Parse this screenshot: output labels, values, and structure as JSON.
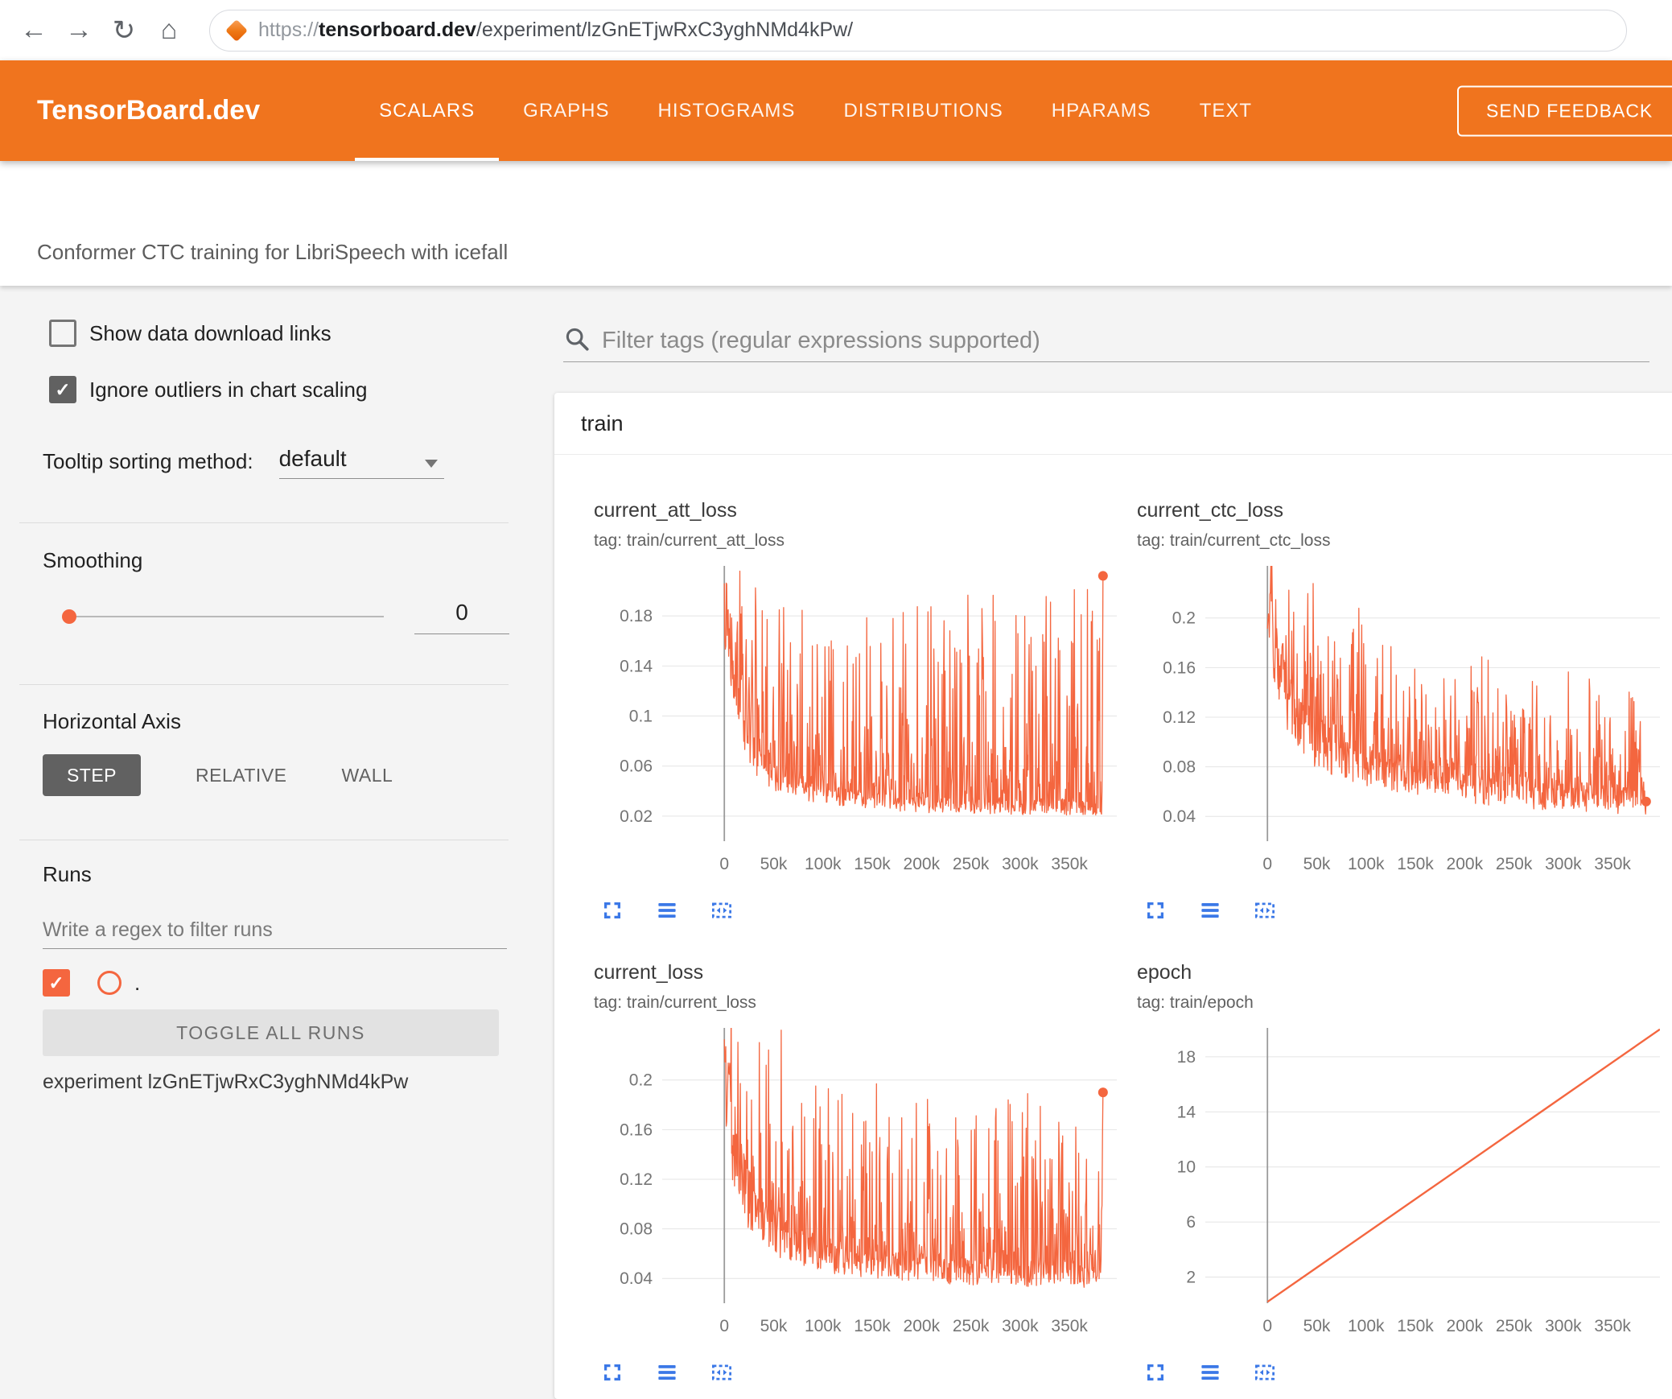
{
  "browser": {
    "url_scheme": "https://",
    "url_domain": "tensorboard.dev",
    "url_path": "/experiment/lzGnETjwRxC3yghNMd4kPw/"
  },
  "header": {
    "logo": "TensorBoard.dev",
    "tabs": [
      {
        "label": "SCALARS",
        "active": true
      },
      {
        "label": "GRAPHS",
        "active": false
      },
      {
        "label": "HISTOGRAMS",
        "active": false
      },
      {
        "label": "DISTRIBUTIONS",
        "active": false
      },
      {
        "label": "HPARAMS",
        "active": false
      },
      {
        "label": "TEXT",
        "active": false
      }
    ],
    "feedback_button": "SEND FEEDBACK"
  },
  "subtitle": "Conformer CTC training for LibriSpeech with icefall",
  "sidebar": {
    "show_download": {
      "label": "Show data download links",
      "checked": false
    },
    "ignore_outliers": {
      "label": "Ignore outliers in chart scaling",
      "checked": true
    },
    "tooltip_sorting": {
      "label": "Tooltip sorting method:",
      "value": "default"
    },
    "smoothing": {
      "label": "Smoothing",
      "value": "0"
    },
    "horizontal_axis": {
      "label": "Horizontal Axis",
      "options": [
        "STEP",
        "RELATIVE",
        "WALL"
      ],
      "selected": "STEP"
    },
    "runs": {
      "label": "Runs",
      "filter_placeholder": "Write a regex to filter runs",
      "run_label": ".",
      "run_checked": true,
      "toggle_button": "TOGGLE ALL RUNS",
      "experiment": "experiment lzGnETjwRxC3yghNMd4kPw"
    }
  },
  "main": {
    "filter_placeholder": "Filter tags (regular expressions supported)",
    "card_title": "train",
    "chart_toolbar_icons": [
      "fullscreen-icon",
      "data-lines-icon",
      "fit-domain-icon"
    ]
  },
  "colors": {
    "header_orange": "#f0741e",
    "run_color": "#f4663f",
    "icon_blue": "#3b78e7",
    "grid": "#e4e4e4",
    "zero_line": "#9a9a9a",
    "axis_text": "#757575"
  },
  "chart_data": [
    {
      "type": "line",
      "title": "current_att_loss",
      "tag": "tag: train/current_att_loss",
      "x_min": -63000,
      "x_max": 398000,
      "y_min": 0,
      "y_max": 0.22,
      "y_ticks": [
        {
          "v": 0.02,
          "label": "0.02"
        },
        {
          "v": 0.06,
          "label": "0.06"
        },
        {
          "v": 0.1,
          "label": "0.1"
        },
        {
          "v": 0.14,
          "label": "0.14"
        },
        {
          "v": 0.18,
          "label": "0.18"
        }
      ],
      "x_ticks": [
        {
          "v": 0,
          "label": "0"
        },
        {
          "v": 50000,
          "label": "50k"
        },
        {
          "v": 100000,
          "label": "100k"
        },
        {
          "v": 150000,
          "label": "150k"
        },
        {
          "v": 200000,
          "label": "200k"
        },
        {
          "v": 250000,
          "label": "250k"
        },
        {
          "v": 300000,
          "label": "300k"
        },
        {
          "v": 350000,
          "label": "350k"
        }
      ],
      "series": [
        {
          "name": ".",
          "max_step": 384000,
          "n_points": 780,
          "seed": 13,
          "spike_pow": 5,
          "stroke_width": 1.3,
          "base": [
            [
              0,
              0.2
            ],
            [
              8000,
              0.15
            ],
            [
              20000,
              0.09
            ],
            [
              40000,
              0.055
            ],
            [
              80000,
              0.042
            ],
            [
              120000,
              0.035
            ],
            [
              180000,
              0.03
            ],
            [
              260000,
              0.028
            ],
            [
              384000,
              0.026
            ]
          ],
          "spike": [
            [
              0,
              0.215
            ],
            [
              20000,
              0.215
            ],
            [
              60000,
              0.2
            ],
            [
              120000,
              0.17
            ],
            [
              200000,
              0.19
            ],
            [
              300000,
              0.2
            ],
            [
              384000,
              0.215
            ]
          ],
          "end_value": 0.212,
          "end_dot": true
        }
      ]
    },
    {
      "type": "line",
      "title": "current_ctc_loss",
      "tag": "tag: train/current_ctc_loss",
      "x_min": -63000,
      "x_max": 398000,
      "y_min": 0.02,
      "y_max": 0.242,
      "y_ticks": [
        {
          "v": 0.04,
          "label": "0.04"
        },
        {
          "v": 0.08,
          "label": "0.08"
        },
        {
          "v": 0.12,
          "label": "0.12"
        },
        {
          "v": 0.16,
          "label": "0.16"
        },
        {
          "v": 0.2,
          "label": "0.2"
        }
      ],
      "x_ticks": [
        {
          "v": 0,
          "label": "0"
        },
        {
          "v": 50000,
          "label": "50k"
        },
        {
          "v": 100000,
          "label": "100k"
        },
        {
          "v": 150000,
          "label": "150k"
        },
        {
          "v": 200000,
          "label": "200k"
        },
        {
          "v": 250000,
          "label": "250k"
        },
        {
          "v": 300000,
          "label": "300k"
        },
        {
          "v": 350000,
          "label": "350k"
        }
      ],
      "series": [
        {
          "name": ".",
          "max_step": 384000,
          "n_points": 780,
          "seed": 29,
          "spike_pow": 5,
          "stroke_width": 1.3,
          "base": [
            [
              0,
              0.22
            ],
            [
              10000,
              0.16
            ],
            [
              25000,
              0.12
            ],
            [
              50000,
              0.1
            ],
            [
              100000,
              0.082
            ],
            [
              150000,
              0.072
            ],
            [
              200000,
              0.065
            ],
            [
              280000,
              0.058
            ],
            [
              384000,
              0.052
            ]
          ],
          "spike": [
            [
              0,
              0.24
            ],
            [
              30000,
              0.24
            ],
            [
              80000,
              0.2
            ],
            [
              150000,
              0.17
            ],
            [
              250000,
              0.16
            ],
            [
              384000,
              0.14
            ]
          ],
          "end_value": 0.052,
          "end_dot": true
        }
      ]
    },
    {
      "type": "line",
      "title": "current_loss",
      "tag": "tag: train/current_loss",
      "x_min": -63000,
      "x_max": 398000,
      "y_min": 0.02,
      "y_max": 0.242,
      "y_ticks": [
        {
          "v": 0.04,
          "label": "0.04"
        },
        {
          "v": 0.08,
          "label": "0.08"
        },
        {
          "v": 0.12,
          "label": "0.12"
        },
        {
          "v": 0.16,
          "label": "0.16"
        },
        {
          "v": 0.2,
          "label": "0.2"
        }
      ],
      "x_ticks": [
        {
          "v": 0,
          "label": "0"
        },
        {
          "v": 50000,
          "label": "50k"
        },
        {
          "v": 100000,
          "label": "100k"
        },
        {
          "v": 150000,
          "label": "150k"
        },
        {
          "v": 200000,
          "label": "200k"
        },
        {
          "v": 250000,
          "label": "250k"
        },
        {
          "v": 300000,
          "label": "300k"
        },
        {
          "v": 350000,
          "label": "350k"
        }
      ],
      "series": [
        {
          "name": ".",
          "max_step": 384000,
          "n_points": 780,
          "seed": 47,
          "spike_pow": 5,
          "stroke_width": 1.3,
          "base": [
            [
              0,
              0.22
            ],
            [
              10000,
              0.14
            ],
            [
              30000,
              0.09
            ],
            [
              60000,
              0.07
            ],
            [
              100000,
              0.058
            ],
            [
              160000,
              0.05
            ],
            [
              240000,
              0.045
            ],
            [
              384000,
              0.04
            ]
          ],
          "spike": [
            [
              0,
              0.24
            ],
            [
              40000,
              0.24
            ],
            [
              100000,
              0.21
            ],
            [
              180000,
              0.19
            ],
            [
              280000,
              0.19
            ],
            [
              384000,
              0.16
            ]
          ],
          "end_value": 0.19,
          "end_dot": true
        }
      ]
    },
    {
      "type": "line",
      "title": "epoch",
      "tag": "tag: train/epoch",
      "x_min": -63000,
      "x_max": 398000,
      "y_min": 0.1,
      "y_max": 20.1,
      "y_ticks": [
        {
          "v": 2,
          "label": "2"
        },
        {
          "v": 6,
          "label": "6"
        },
        {
          "v": 10,
          "label": "10"
        },
        {
          "v": 14,
          "label": "14"
        },
        {
          "v": 18,
          "label": "18"
        }
      ],
      "x_ticks": [
        {
          "v": 0,
          "label": "0"
        },
        {
          "v": 50000,
          "label": "50k"
        },
        {
          "v": 100000,
          "label": "100k"
        },
        {
          "v": 150000,
          "label": "150k"
        },
        {
          "v": 200000,
          "label": "200k"
        },
        {
          "v": 250000,
          "label": "250k"
        },
        {
          "v": 300000,
          "label": "300k"
        },
        {
          "v": 350000,
          "label": "350k"
        }
      ],
      "series": [
        {
          "name": ".",
          "stroke_width": 2.4,
          "line": [
            [
              0,
              0.2
            ],
            [
              398000,
              20.0
            ]
          ],
          "end_dot": false
        }
      ]
    }
  ]
}
